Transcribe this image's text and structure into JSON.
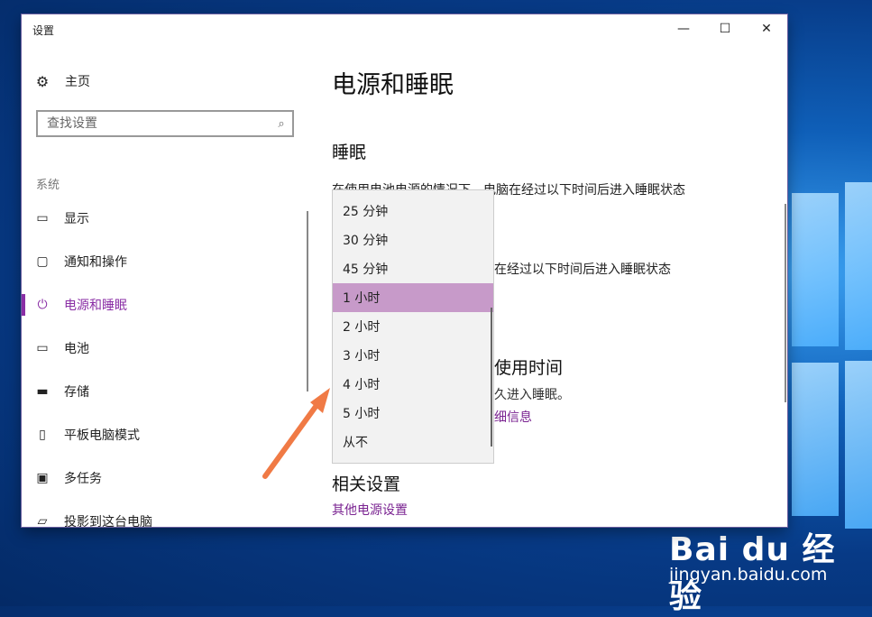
{
  "window": {
    "title": "设置",
    "minimize": "—",
    "maximize": "☐",
    "close": "✕"
  },
  "sidebar": {
    "home_label": "主页",
    "search_placeholder": "查找设置",
    "category": "系统",
    "items": [
      {
        "label": "显示",
        "icon": "display-icon",
        "active": false
      },
      {
        "label": "通知和操作",
        "icon": "notification-icon",
        "active": false
      },
      {
        "label": "电源和睡眠",
        "icon": "power-icon",
        "active": true
      },
      {
        "label": "电池",
        "icon": "battery-icon",
        "active": false
      },
      {
        "label": "存储",
        "icon": "storage-icon",
        "active": false
      },
      {
        "label": "平板电脑模式",
        "icon": "tablet-icon",
        "active": false
      },
      {
        "label": "多任务",
        "icon": "multitask-icon",
        "active": false
      },
      {
        "label": "投影到这台电脑",
        "icon": "projection-icon",
        "active": false
      }
    ]
  },
  "main": {
    "title": "电源和睡眠",
    "sleep_heading": "睡眠",
    "battery_desc": "在使用电池电源的情况下，电脑在经过以下时间后进入睡眠状态",
    "plugged_desc_partial": "在经过以下时间后进入睡眠状态",
    "usage_heading_partial": "使用时间",
    "usage_desc_partial": "久进入睡眠。",
    "more_info_link_partial": "细信息",
    "related_heading": "相关设置",
    "other_power_link": "其他电源设置"
  },
  "dropdown": {
    "options": [
      "25 分钟",
      "30 分钟",
      "45 分钟",
      "1 小时",
      "2 小时",
      "3 小时",
      "4 小时",
      "5 小时",
      "从不"
    ],
    "selected_index": 3
  },
  "watermark": {
    "brand": "Bai du 经验",
    "url": "jingyan.baidu.com"
  },
  "colors": {
    "accent": "#8a2ea5",
    "selected_option": "#c79ac9",
    "link": "#7a2391",
    "arrow": "#f07a45"
  }
}
